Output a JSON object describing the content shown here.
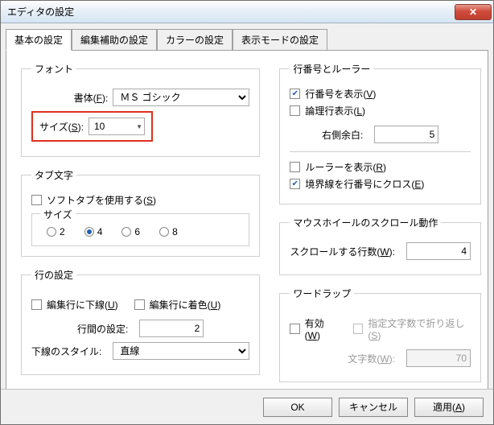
{
  "window": {
    "title": "エディタの設定"
  },
  "tabs": [
    "基本の設定",
    "編集補助の設定",
    "カラーの設定",
    "表示モードの設定"
  ],
  "font": {
    "legend": "フォント",
    "face_label": "書体(F):",
    "face_value": "ＭＳ ゴシック",
    "size_label": "サイズ(S):",
    "size_value": "10"
  },
  "tabchar": {
    "legend": "タブ文字",
    "softtab_label": "ソフトタブを使用する(S)",
    "size_legend": "サイズ",
    "options": [
      "2",
      "4",
      "6",
      "8"
    ],
    "selected": "4"
  },
  "line": {
    "legend": "行の設定",
    "underline_label": "編集行に下線(U)",
    "color_label": "編集行に着色(U)",
    "spacing_label": "行間の設定:",
    "spacing_value": "2",
    "underline_style_label": "下線のスタイル:",
    "underline_style_value": "直線"
  },
  "linenum": {
    "legend": "行番号とルーラー",
    "show_lineno_label": "行番号を表示(V)",
    "logical_label": "論理行表示(L)",
    "right_margin_label": "右側余白:",
    "right_margin_value": "5",
    "show_ruler_label": "ルーラーを表示(R)",
    "cross_label": "境界線を行番号にクロス(E)"
  },
  "wheel": {
    "legend": "マウスホイールのスクロール動作",
    "rows_label": "スクロールする行数(W):",
    "rows_value": "4"
  },
  "wrap": {
    "legend": "ワードラップ",
    "enable_label": "有効(W)",
    "wrap_at_chars_label": "指定文字数で折り返し(S)",
    "chars_label": "文字数(W):",
    "chars_value": "70"
  },
  "buttons": {
    "ok": "OK",
    "cancel": "キャンセル",
    "apply": "適用(A)"
  }
}
